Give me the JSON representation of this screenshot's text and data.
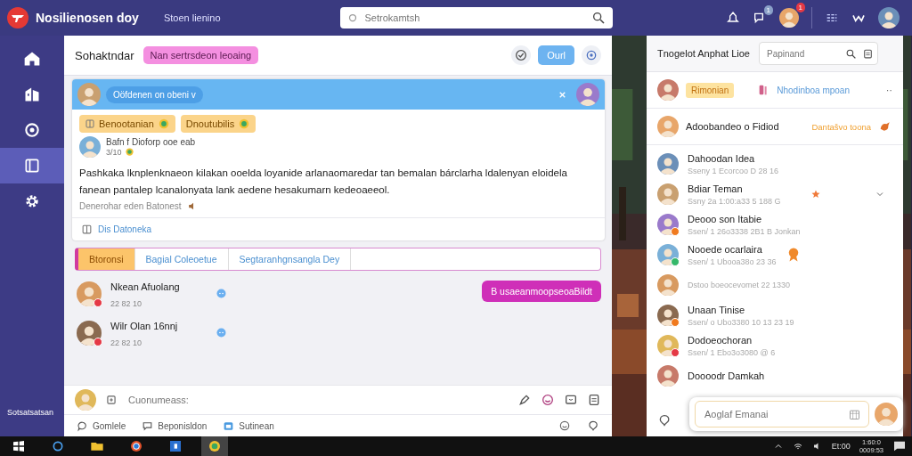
{
  "topbar": {
    "app_title": "Nosilienosen doy",
    "subtitle": "Stoen lienino",
    "search": {
      "placeholder": "Setrokamtsh"
    },
    "badges": [
      {
        "kind": "chat",
        "count": "1"
      },
      {
        "kind": "avatar",
        "count": "1"
      }
    ]
  },
  "sidebar": {
    "items": [
      {
        "kind": "home",
        "selected": false
      },
      {
        "kind": "building",
        "selected": false
      },
      {
        "kind": "target",
        "selected": false
      },
      {
        "kind": "panel",
        "selected": true
      },
      {
        "kind": "gear",
        "selected": false
      }
    ],
    "footer": "Sotsatsatsan"
  },
  "header": {
    "title": "Sohaktndar",
    "tag": "Nan sertrsdeon leoaing",
    "button": "Ourl"
  },
  "post": {
    "pill": "Oöfdenen on obeni v",
    "tags": [
      "Benootanian",
      "Dnoutubilis"
    ],
    "author": "Bafn f Dioforp ooe  eab",
    "time": "3/10",
    "body": "Pashkaka lknplenknaeon kilakan ooelda loyanide arlanaomaredar tan bemalan bárclarha ldalenyan eloidela fanean pantalep lcanalonyata lank aedene hesakumarn kedeoaeeol.",
    "note": "Denerohar eden Batonest",
    "footer_link": "Dis Datoneka"
  },
  "tabs": [
    {
      "label": "Btoronsi",
      "selected": true
    },
    {
      "label": "Bagial Coleoetue",
      "selected": false
    },
    {
      "label": "Segtaranhgnsangla Dey",
      "selected": false
    }
  ],
  "messages": [
    {
      "name": "Nkean Afuolang",
      "time": "22 82 10",
      "color": "#e53945"
    },
    {
      "name": "Wilr Olan 16nnj",
      "time": "22 82 10",
      "color": "#e53945"
    }
  ],
  "action_button": "B usaeanmoopseoaBildt",
  "composer": {
    "placeholder": "Cuonumeass:"
  },
  "actions": [
    {
      "kind": "comment",
      "label": "Gomlele"
    },
    {
      "kind": "note",
      "label": "Beponisldon"
    },
    {
      "kind": "calendar",
      "label": "Sutinean"
    }
  ],
  "right_panel": {
    "title": "Tnogelot Anphat Lioe",
    "search": {
      "placeholder": "Papinand"
    },
    "pinned": {
      "badge": "Rimonian",
      "link": "Nhodinboa mpoan",
      "more": "··"
    },
    "featured": {
      "name": "Adoobandeo o Fidiod",
      "link": "Dantašvo toona"
    },
    "contacts": [
      {
        "name": "Dahoodan Idea",
        "sub": "Sseny 1 Ecorcoo  D 28 16",
        "kind": "plain"
      },
      {
        "name": "Bdiar Teman",
        "sub": "Ssny 2a 1:00:a33 5  188 G",
        "kind": "star"
      },
      {
        "name": "Deooo son Itabie",
        "sub": "Ssen/ 1 26o3338  2B1  B Jonkan",
        "color": "#f07a1f",
        "kind": "plain"
      },
      {
        "name": "Nooede ocarlaira",
        "sub": "Ssen/ 1 Ubooa38o  23 36",
        "color": "#35b86a",
        "kind": "ribbon"
      },
      {
        "sub": "Dstoo boeocevomet  22 1330",
        "kind": "plain"
      },
      {
        "name": "Unaan Tinise",
        "sub": "Ssen/ o Ubo3380  10 13 23 19",
        "color": "#f07a1f",
        "kind": "plain"
      },
      {
        "name": "Dodoeochoran",
        "sub": "Ssen/ 1 Ebo3o3080  @ 6",
        "color": "#e53945",
        "kind": "plain"
      },
      {
        "name": "Doooodr Damkah",
        "kind": "plain"
      }
    ],
    "input": {
      "placeholder": "Aoglaf Emanai"
    }
  },
  "taskbar": {
    "tray": "Et:00",
    "time": "1:60:0",
    "date": "0009:53"
  }
}
